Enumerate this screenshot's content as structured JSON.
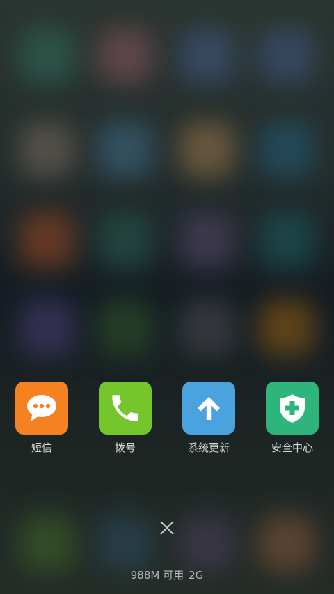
{
  "recent_apps": [
    {
      "label": "短信",
      "icon": "message-icon",
      "color": "#f58220"
    },
    {
      "label": "拨号",
      "icon": "phone-icon",
      "color": "#74c62c"
    },
    {
      "label": "系统更新",
      "icon": "arrow-up-icon",
      "color": "#4aa3de"
    },
    {
      "label": "安全中心",
      "icon": "shield-plus-icon",
      "color": "#2db57c"
    }
  ],
  "close_all": {
    "icon": "close-icon"
  },
  "memory": {
    "available": "988M 可用",
    "total": "2G"
  }
}
